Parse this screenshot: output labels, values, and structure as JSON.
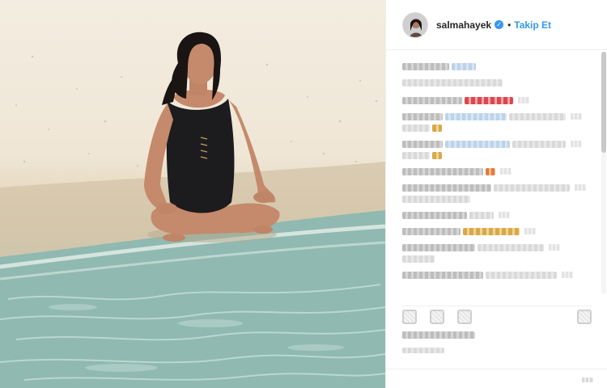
{
  "post": {
    "username": "salmahayek",
    "verified_mark": "✓",
    "separator": "•",
    "follow_label": "Takip Et"
  },
  "icons": {
    "avatar": "avatar-icon",
    "verified": "verified-badge-icon",
    "like": "heart-icon",
    "comment": "comment-icon",
    "share": "share-icon",
    "save": "bookmark-icon"
  },
  "colors": {
    "accent": "#3897f0",
    "text": "#262626",
    "border": "#efefef"
  },
  "comments_obscured": true
}
